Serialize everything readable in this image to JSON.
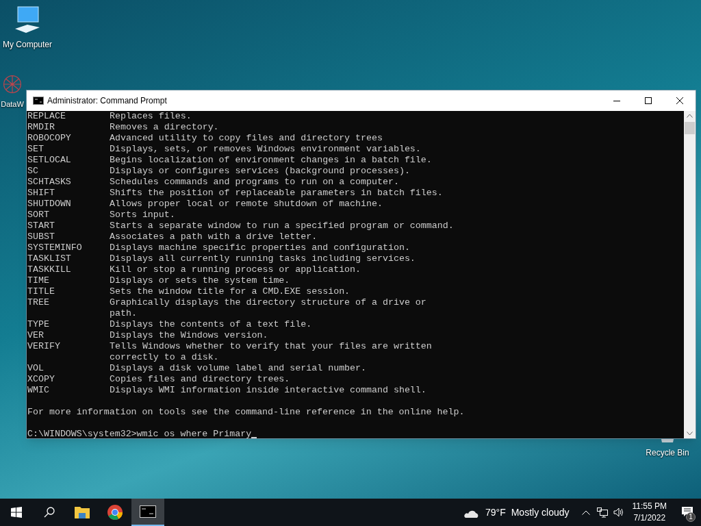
{
  "desktop_icons": [
    {
      "kind": "computer",
      "label": "My Computer"
    },
    {
      "kind": "network",
      "label": "DataW"
    },
    {
      "kind": "bin",
      "label": "Recycle Bin"
    }
  ],
  "window": {
    "title": "Administrator: Command Prompt"
  },
  "console": {
    "commands": [
      {
        "name": "REPLACE",
        "lines": [
          "Replaces files."
        ]
      },
      {
        "name": "RMDIR",
        "lines": [
          "Removes a directory."
        ]
      },
      {
        "name": "ROBOCOPY",
        "lines": [
          "Advanced utility to copy files and directory trees"
        ]
      },
      {
        "name": "SET",
        "lines": [
          "Displays, sets, or removes Windows environment variables."
        ]
      },
      {
        "name": "SETLOCAL",
        "lines": [
          "Begins localization of environment changes in a batch file."
        ]
      },
      {
        "name": "SC",
        "lines": [
          "Displays or configures services (background processes)."
        ]
      },
      {
        "name": "SCHTASKS",
        "lines": [
          "Schedules commands and programs to run on a computer."
        ]
      },
      {
        "name": "SHIFT",
        "lines": [
          "Shifts the position of replaceable parameters in batch files."
        ]
      },
      {
        "name": "SHUTDOWN",
        "lines": [
          "Allows proper local or remote shutdown of machine."
        ]
      },
      {
        "name": "SORT",
        "lines": [
          "Sorts input."
        ]
      },
      {
        "name": "START",
        "lines": [
          "Starts a separate window to run a specified program or command."
        ]
      },
      {
        "name": "SUBST",
        "lines": [
          "Associates a path with a drive letter."
        ]
      },
      {
        "name": "SYSTEMINFO",
        "lines": [
          "Displays machine specific properties and configuration."
        ]
      },
      {
        "name": "TASKLIST",
        "lines": [
          "Displays all currently running tasks including services."
        ]
      },
      {
        "name": "TASKKILL",
        "lines": [
          "Kill or stop a running process or application."
        ]
      },
      {
        "name": "TIME",
        "lines": [
          "Displays or sets the system time."
        ]
      },
      {
        "name": "TITLE",
        "lines": [
          "Sets the window title for a CMD.EXE session."
        ]
      },
      {
        "name": "TREE",
        "lines": [
          "Graphically displays the directory structure of a drive or",
          "path."
        ]
      },
      {
        "name": "TYPE",
        "lines": [
          "Displays the contents of a text file."
        ]
      },
      {
        "name": "VER",
        "lines": [
          "Displays the Windows version."
        ]
      },
      {
        "name": "VERIFY",
        "lines": [
          "Tells Windows whether to verify that your files are written",
          "correctly to a disk."
        ]
      },
      {
        "name": "VOL",
        "lines": [
          "Displays a disk volume label and serial number."
        ]
      },
      {
        "name": "XCOPY",
        "lines": [
          "Copies files and directory trees."
        ]
      },
      {
        "name": "WMIC",
        "lines": [
          "Displays WMI information inside interactive command shell."
        ]
      }
    ],
    "info": "For more information on tools see the command-line reference in the online help.",
    "prompt": "C:\\WINDOWS\\system32>wmic os where Primary"
  },
  "taskbar": {
    "apps": [
      {
        "kind": "explorer",
        "selected": false
      },
      {
        "kind": "chrome",
        "selected": false
      },
      {
        "kind": "cmd",
        "selected": true
      }
    ],
    "temperature": "79°F",
    "weather": "Mostly cloudy",
    "time": "11:55 PM",
    "date": "7/1/2022",
    "notifications": "1"
  }
}
